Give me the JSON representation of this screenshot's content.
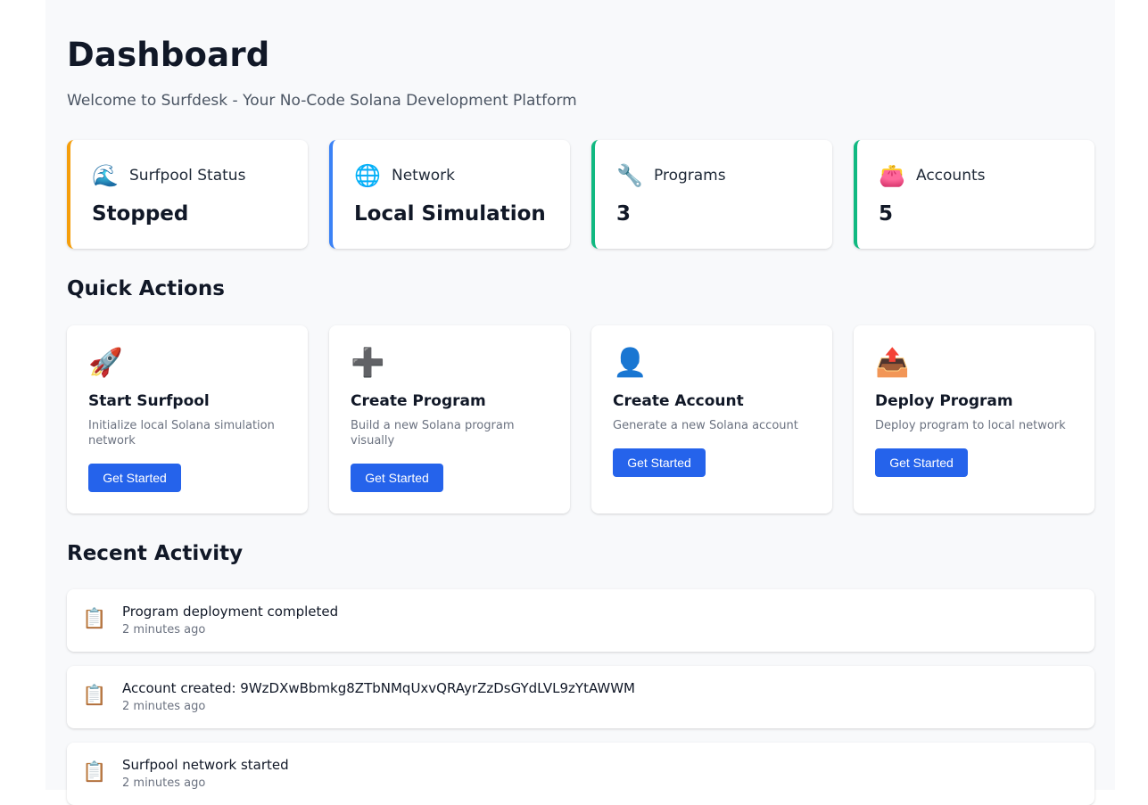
{
  "header": {
    "title": "Dashboard",
    "subtitle": "Welcome to Surfdesk - Your No-Code Solana Development Platform"
  },
  "stats": [
    {
      "icon": "wave-icon",
      "glyph": "🌊",
      "label": "Surfpool Status",
      "value": "Stopped",
      "accent": "#f59e0b"
    },
    {
      "icon": "globe-icon",
      "glyph": "🌐",
      "label": "Network",
      "value": "Local Simulation",
      "accent": "#3b82f6"
    },
    {
      "icon": "wrench-icon",
      "glyph": "🔧",
      "label": "Programs",
      "value": "3",
      "accent": "#10b981"
    },
    {
      "icon": "purse-icon",
      "glyph": "👛",
      "label": "Accounts",
      "value": "5",
      "accent": "#10b981"
    }
  ],
  "quick_actions": {
    "title": "Quick Actions",
    "items": [
      {
        "icon": "rocket-icon",
        "glyph": "🚀",
        "title": "Start Surfpool",
        "description": "Initialize local Solana simulation network",
        "button": "Get Started"
      },
      {
        "icon": "plus-icon",
        "glyph": "➕",
        "title": "Create Program",
        "description": "Build a new Solana program visually",
        "button": "Get Started"
      },
      {
        "icon": "user-icon",
        "glyph": "👤",
        "title": "Create Account",
        "description": "Generate a new Solana account",
        "button": "Get Started"
      },
      {
        "icon": "outbox-icon",
        "glyph": "📤",
        "title": "Deploy Program",
        "description": "Deploy program to local network",
        "button": "Get Started"
      }
    ]
  },
  "recent_activity": {
    "title": "Recent Activity",
    "items": [
      {
        "icon": "clipboard-icon",
        "glyph": "📋",
        "title": "Program deployment completed",
        "time": "2 minutes ago"
      },
      {
        "icon": "clipboard-icon",
        "glyph": "📋",
        "title": "Account created: 9WzDXwBbmkg8ZTbNMqUxvQRAyrZzDsGYdLVL9zYtAWWM",
        "time": "2 minutes ago"
      },
      {
        "icon": "clipboard-icon",
        "glyph": "📋",
        "title": "Surfpool network started",
        "time": "2 minutes ago"
      }
    ]
  }
}
